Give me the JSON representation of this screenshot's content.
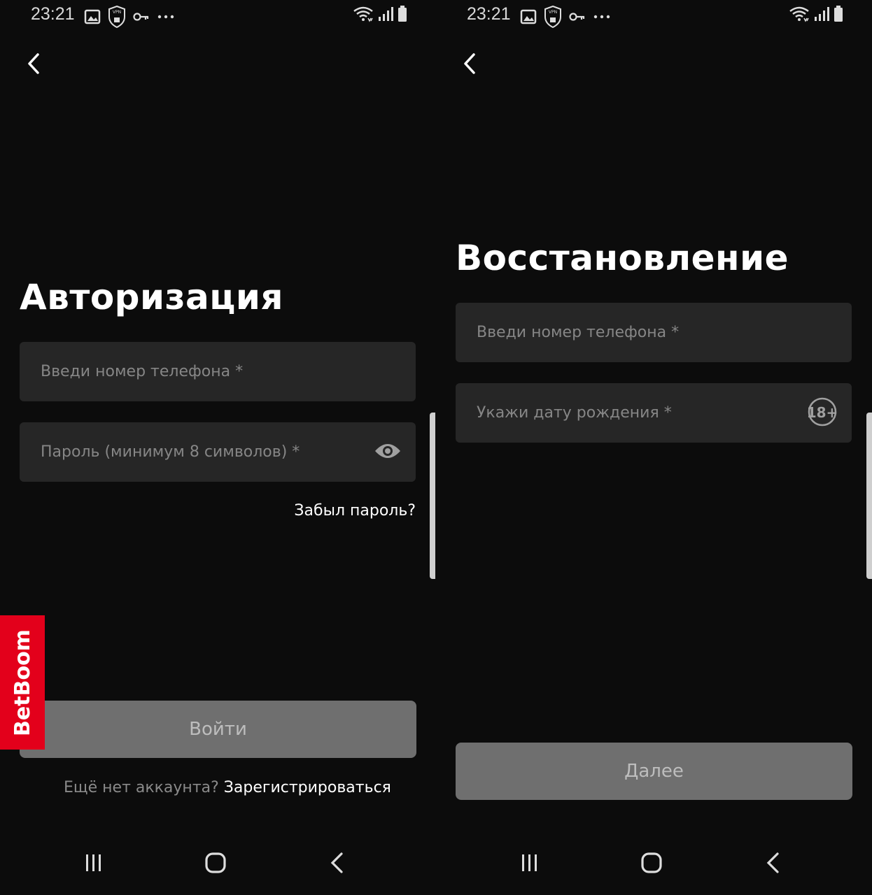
{
  "status_bar": {
    "time": "23:21",
    "vpn_label": "VPN"
  },
  "login": {
    "title": "Авторизация",
    "phone_placeholder": "Введи номер телефона *",
    "password_placeholder": "Пароль (минимум 8 символов) *",
    "forgot_link": "Забыл пароль?",
    "submit_label": "Войти",
    "no_account_text": "Ещё нет аккаунта?",
    "register_link": "Зарегистрироваться"
  },
  "recovery": {
    "title": "Восстановление",
    "phone_placeholder": "Введи номер телефона *",
    "birthdate_placeholder": "Укажи дату рождения *",
    "age_badge": "18+",
    "next_label": "Далее"
  },
  "brand": {
    "name": "BetBoom",
    "color": "#e3001b"
  },
  "icons": {
    "back": "chevron-left-icon",
    "eye": "eye-icon",
    "recent_apps": "recent-apps-icon",
    "home": "home-icon",
    "nav_back": "nav-back-icon",
    "gallery": "gallery-icon",
    "vpn": "vpn-shield-icon",
    "key": "key-icon",
    "more": "more-icon",
    "wifi": "wifi-icon",
    "signal": "signal-icon",
    "battery": "battery-icon"
  },
  "colors": {
    "background": "#0c0c0c",
    "field": "#262626",
    "button_disabled": "#6f6f6f",
    "placeholder": "#868686"
  }
}
